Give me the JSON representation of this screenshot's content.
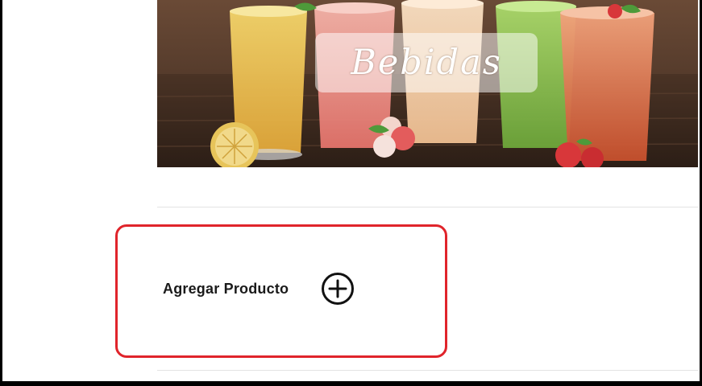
{
  "banner": {
    "title": "Bebidas",
    "image": "drinks-banner"
  },
  "add_product": {
    "label": "Agregar Producto",
    "icon": "plus-circle-icon"
  },
  "colors": {
    "highlight_border": "#e0242b",
    "text": "#1a1a1a",
    "separator": "#e3e3e3"
  }
}
